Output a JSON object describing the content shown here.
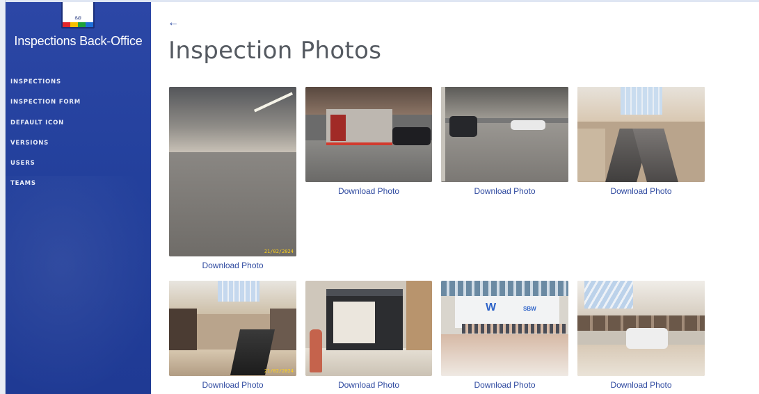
{
  "app": {
    "brand": "Inspections Back-Office",
    "logo_text": "ẞØ"
  },
  "sidebar": {
    "items": [
      {
        "label": "INSPECTIONS"
      },
      {
        "label": "INSPECTION FORM"
      },
      {
        "label": "DEFAULT ICON"
      },
      {
        "label": "VERSIONS"
      },
      {
        "label": "USERS"
      },
      {
        "label": "TEAMS"
      }
    ]
  },
  "header": {
    "back_icon": "←",
    "title": "Inspection Photos"
  },
  "photos": [
    {
      "download_label": "Download Photo",
      "date": "21/02/2024"
    },
    {
      "download_label": "Download Photo",
      "date": ""
    },
    {
      "download_label": "Download Photo",
      "date": ""
    },
    {
      "download_label": "Download Photo",
      "date": ""
    },
    {
      "download_label": "Download Photo",
      "date": "21/02/2024"
    },
    {
      "download_label": "Download Photo",
      "date": ""
    },
    {
      "download_label": "Download Photo",
      "date": ""
    },
    {
      "download_label": "Download Photo",
      "date": ""
    }
  ],
  "colors": {
    "sidebar_bg": "#2a45a3",
    "link": "#2f4aa0",
    "title": "#555a61"
  }
}
